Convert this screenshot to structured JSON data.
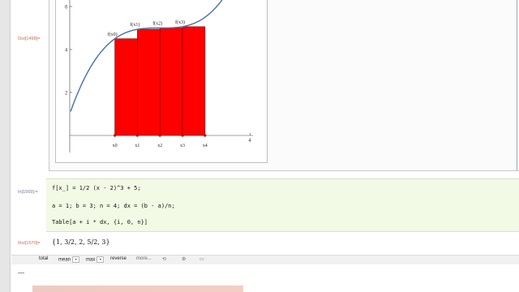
{
  "cells": {
    "out_graph_label": "Out[1498]=",
    "in_label": "In[1569]:=",
    "out_list_label": "Out[1570]="
  },
  "graph": {
    "y_ticks": [
      "2",
      "4",
      "6"
    ],
    "x_tick_right": "4",
    "point_labels": [
      "f(x0)",
      "f(x1)",
      "f(x2)",
      "f(x3)"
    ],
    "x_labels": [
      "x0",
      "x1",
      "x2",
      "x3",
      "x4"
    ]
  },
  "input": {
    "line1": "f[x_] = 1/2 (x - 2)^3 + 5;",
    "line2": "a = 1; b = 3; n = 4; dx = (b - a)/n;",
    "line3": "Table[a + i * dx, {i, 0, n}]"
  },
  "output": {
    "text": "{1, 3/2, 2, 5/2, 3}"
  },
  "toolbar": {
    "total": "total",
    "mean": "mean",
    "max": "max",
    "reverse": "reverse",
    "more": "more..."
  },
  "colors": {
    "rect_fill": "#ff0000",
    "curve": "#4a6fa5",
    "input_bg": "#f2f9e4",
    "label": "#cc6a50"
  },
  "chart_data": {
    "type": "line",
    "title": "",
    "xlabel": "",
    "ylabel": "",
    "xlim": [
      0.1,
      4.1
    ],
    "ylim": [
      -0.6,
      6.6
    ],
    "series": [
      {
        "values_fn": "1/2 (x - 2)^3 + 5",
        "x": [
          0.1,
          0.4,
          0.7,
          1.0,
          1.3,
          1.6,
          1.9,
          2.2,
          2.5,
          2.8,
          3.1,
          3.4
        ],
        "y": [
          1.57,
          2.81,
          3.63,
          4.5,
          4.83,
          4.97,
          5.0,
          5.0,
          5.06,
          5.26,
          5.67,
          6.37
        ]
      }
    ],
    "rectangles": {
      "x_left": [
        1,
        1.5,
        2,
        2.5
      ],
      "width": 0.5,
      "heights": [
        4.5,
        4.94,
        5.0,
        5.06
      ]
    },
    "partition": [
      1,
      1.5,
      2,
      2.5,
      3
    ]
  }
}
